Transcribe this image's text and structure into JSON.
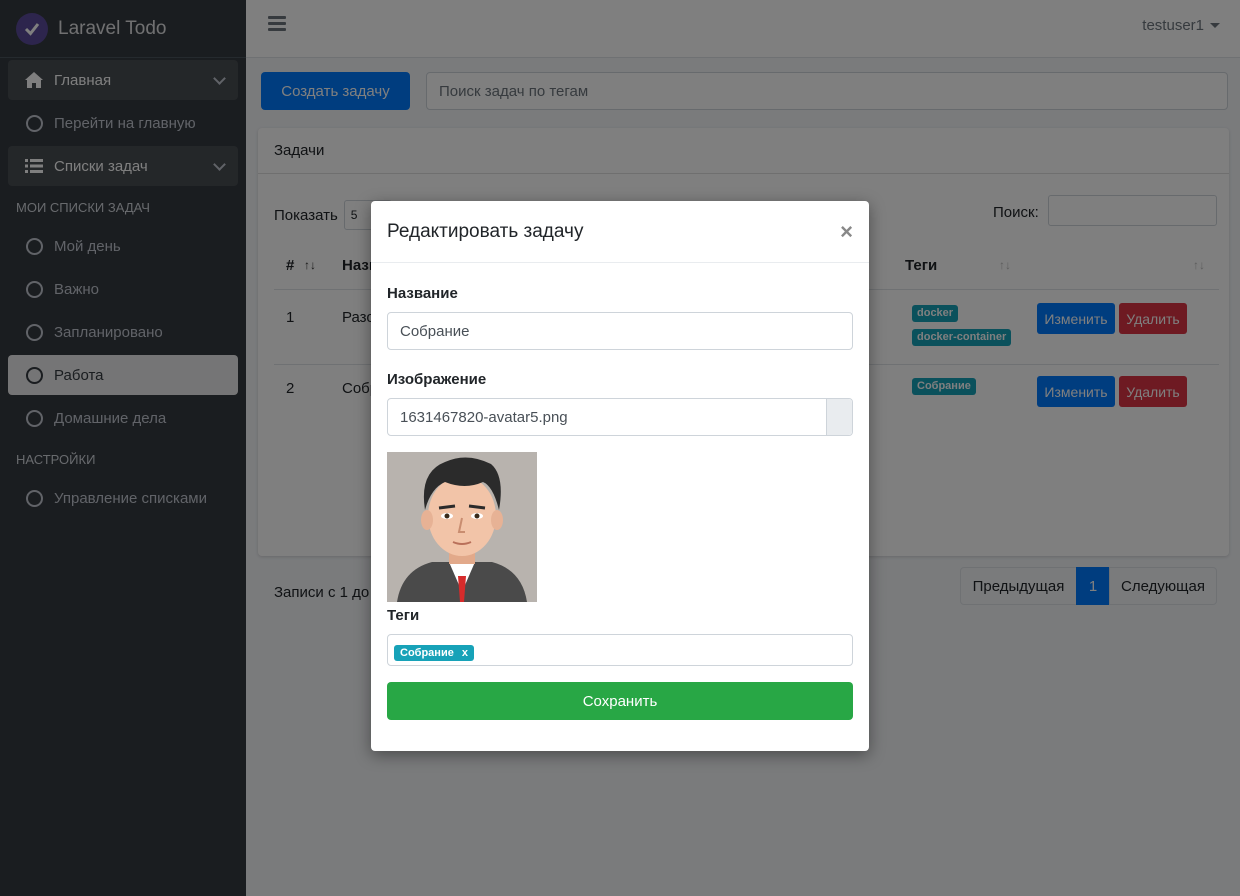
{
  "app": {
    "brand": "Laravel Todo",
    "user": "testuser1"
  },
  "sidebar": {
    "home": "Главная",
    "go_home": "Перейти на главную",
    "lists": "Списки задач",
    "header_my_lists": "МОИ СПИСКИ ЗАДАЧ",
    "my_lists": [
      "Мой день",
      "Важно",
      "Запланировано",
      "Работа",
      "Домашние дела"
    ],
    "header_settings": "НАСТРОЙКИ",
    "manage_lists": "Управление списками"
  },
  "toolbar": {
    "create_label": "Создать задачу",
    "tag_search_placeholder": "Поиск задач по тегам"
  },
  "card": {
    "title": "Задачи",
    "show_label": "Показать",
    "page_length": "5",
    "search_label": "Поиск:",
    "columns": {
      "num": "#",
      "name": "Назв",
      "tags": "Теги"
    },
    "rows": [
      {
        "num": "1",
        "name": "Разо",
        "tags": [
          "docker",
          "docker-container"
        ]
      },
      {
        "num": "2",
        "name": "Собр",
        "tags": [
          "Собрание"
        ]
      }
    ],
    "edit_label": "Изменить",
    "delete_label": "Удалить",
    "info": "Записи с 1 до",
    "pagination": {
      "prev": "Предыдущая",
      "page": "1",
      "next": "Следующая"
    }
  },
  "modal": {
    "title": "Редактировать задачу",
    "close": "×",
    "name_label": "Название",
    "name_value": "Собрание",
    "image_label": "Изображение",
    "image_file": "1631467820-avatar5.png",
    "tags_label": "Теги",
    "tag": "Собрание",
    "tag_remove": "x",
    "save_label": "Сохранить"
  },
  "colors": {
    "primary": "#007bff",
    "danger": "#dc3545",
    "success": "#28a745",
    "info": "#17a2b8",
    "sidebar": "#343a40"
  }
}
